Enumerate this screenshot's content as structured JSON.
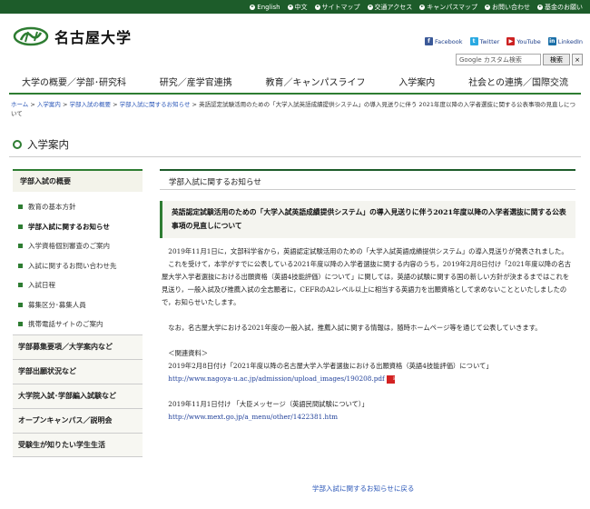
{
  "topbar": {
    "links": [
      "English",
      "中文",
      "サイトマップ",
      "交通アクセス",
      "キャンパスマップ",
      "お問い合わせ",
      "基金のお願い"
    ]
  },
  "header": {
    "logo_text": "名古屋大学",
    "social": [
      {
        "label": "Facebook",
        "icon": "facebook-icon",
        "color": "#3b5998",
        "glyph": "f"
      },
      {
        "label": "Twitter",
        "icon": "twitter-icon",
        "color": "#29a9e1",
        "glyph": "t"
      },
      {
        "label": "YouTube",
        "icon": "youtube-icon",
        "color": "#cc2222",
        "glyph": "▶"
      },
      {
        "label": "LinkedIn",
        "icon": "linkedin-icon",
        "color": "#1a6fa8",
        "glyph": "in"
      }
    ],
    "search_placeholder": "Google カスタム検索",
    "search_button": "検索",
    "clear_button": "×"
  },
  "mainnav": [
    "大学の概要／学部･研究科",
    "研究／産学官連携",
    "教育／キャンパスライフ",
    "入学案内",
    "社会との連携／国際交流"
  ],
  "breadcrumb": {
    "links": [
      "ホーム",
      "入学案内",
      "学部入試の概要",
      "学部入試に関するお知らせ"
    ],
    "separator": " > ",
    "current": "英語認定試験活用のための「大学入試英語成績提供システム」の導入見送りに伴う 2021年度以降の入学者選抜に関する公表事項の見直しについて"
  },
  "page_title": "入学案内",
  "sidebar": {
    "head": "学部入試の概要",
    "items": [
      {
        "label": "教育の基本方針",
        "active": false
      },
      {
        "label": "学部入試に関するお知らせ",
        "active": true
      },
      {
        "label": "入学資格個別審査のご案内",
        "active": false
      },
      {
        "label": "入試に関するお問い合わせ先",
        "active": false
      },
      {
        "label": "入試日程",
        "active": false
      },
      {
        "label": "募集区分･募集人員",
        "active": false
      },
      {
        "label": "携帯電話サイトのご案内",
        "active": false
      }
    ],
    "sections": [
      "学部募集要項／大学案内など",
      "学部出願状況など",
      "大学院入試･学部編入試験など",
      "オープンキャンパス／説明会",
      "受験生が知りたい学生生活"
    ]
  },
  "content": {
    "section_head": "学部入試に関するお知らせ",
    "article_title": "英語認定試験活用のための「大学入試英語成績提供システム」の導入見送りに伴う2021年度以降の入学者選抜に関する公表事項の見直しについて",
    "paragraphs": [
      "2019年11月1日に，文部科学省から，英語認定試験活用のための「大学入試英語成績提供システム」の導入見送りが発表されました。",
      "これを受けて，本学がすでに公表している2021年度以降の入学者選抜に関する内容のうち，2019年2月8日付け「2021年度以降の名古屋大学入学者選抜における出願資格（英語4技能評価）について」に関しては，英語の試験に関する国の新しい方針が決まるまではこれを見送り，一般入試及び推薦入試の全志願者に，CEFRのA2レベル以上に相当する英語力を出願資格として求めないことといたしましたので，お知らせいたします。",
      "なお，名古屋大学における2021年度の一般入試，推薦入試に関する情報は，随時ホームページ等を通じて公表していきます。"
    ],
    "refs_label": "＜関連資料＞",
    "refs": [
      {
        "text": "2019年2月8日付け「2021年度以降の名古屋大学入学者選抜における出願資格（英語4技能評価）について」",
        "url": "http://www.nagoya-u.ac.jp/admission/upload_images/190208.pdf",
        "pdf": true
      },
      {
        "text": "2019年11月1日付け 「大臣メッセージ（英語民間試験について）」",
        "url": "http://www.mext.go.jp/a_menu/other/1422381.htm",
        "pdf": false
      }
    ],
    "back_link": "学部入試に関するお知らせに戻る"
  }
}
